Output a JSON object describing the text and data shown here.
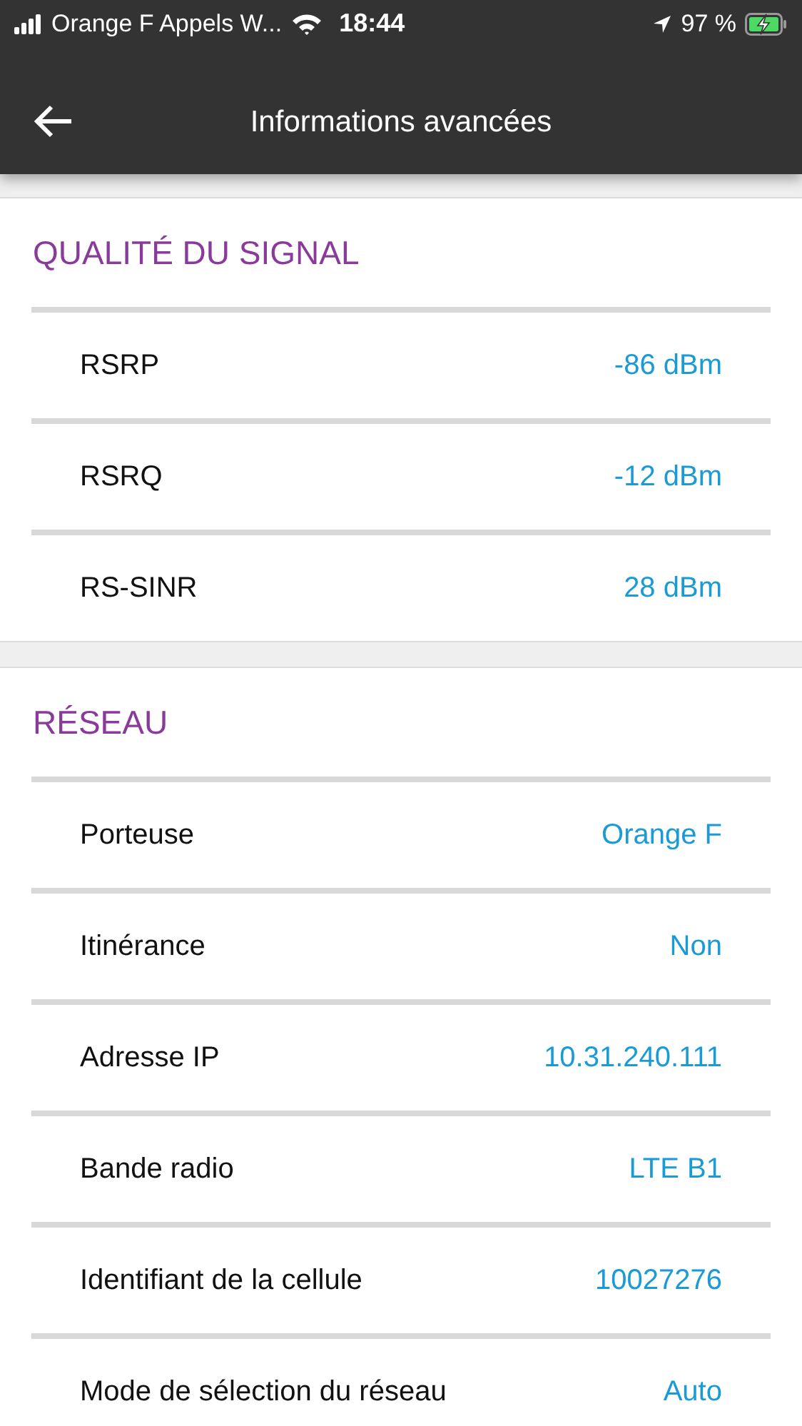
{
  "status_bar": {
    "carrier": "Orange F Appels W...",
    "time": "18:44",
    "battery": "97 %",
    "charging": true
  },
  "header": {
    "title": "Informations avancées"
  },
  "sections": [
    {
      "title": "QUALITÉ DU SIGNAL",
      "rows": [
        {
          "label": "RSRP",
          "value": "-86 dBm"
        },
        {
          "label": "RSRQ",
          "value": "-12 dBm"
        },
        {
          "label": "RS-SINR",
          "value": "28 dBm"
        }
      ]
    },
    {
      "title": "RÉSEAU",
      "rows": [
        {
          "label": "Porteuse",
          "value": "Orange F"
        },
        {
          "label": "Itinérance",
          "value": "Non"
        },
        {
          "label": "Adresse IP",
          "value": "10.31.240.111"
        },
        {
          "label": "Bande radio",
          "value": "LTE B1"
        },
        {
          "label": "Identifiant de la cellule",
          "value": "10027276"
        },
        {
          "label": "Mode de sélection du réseau",
          "value": "Auto"
        }
      ]
    }
  ]
}
